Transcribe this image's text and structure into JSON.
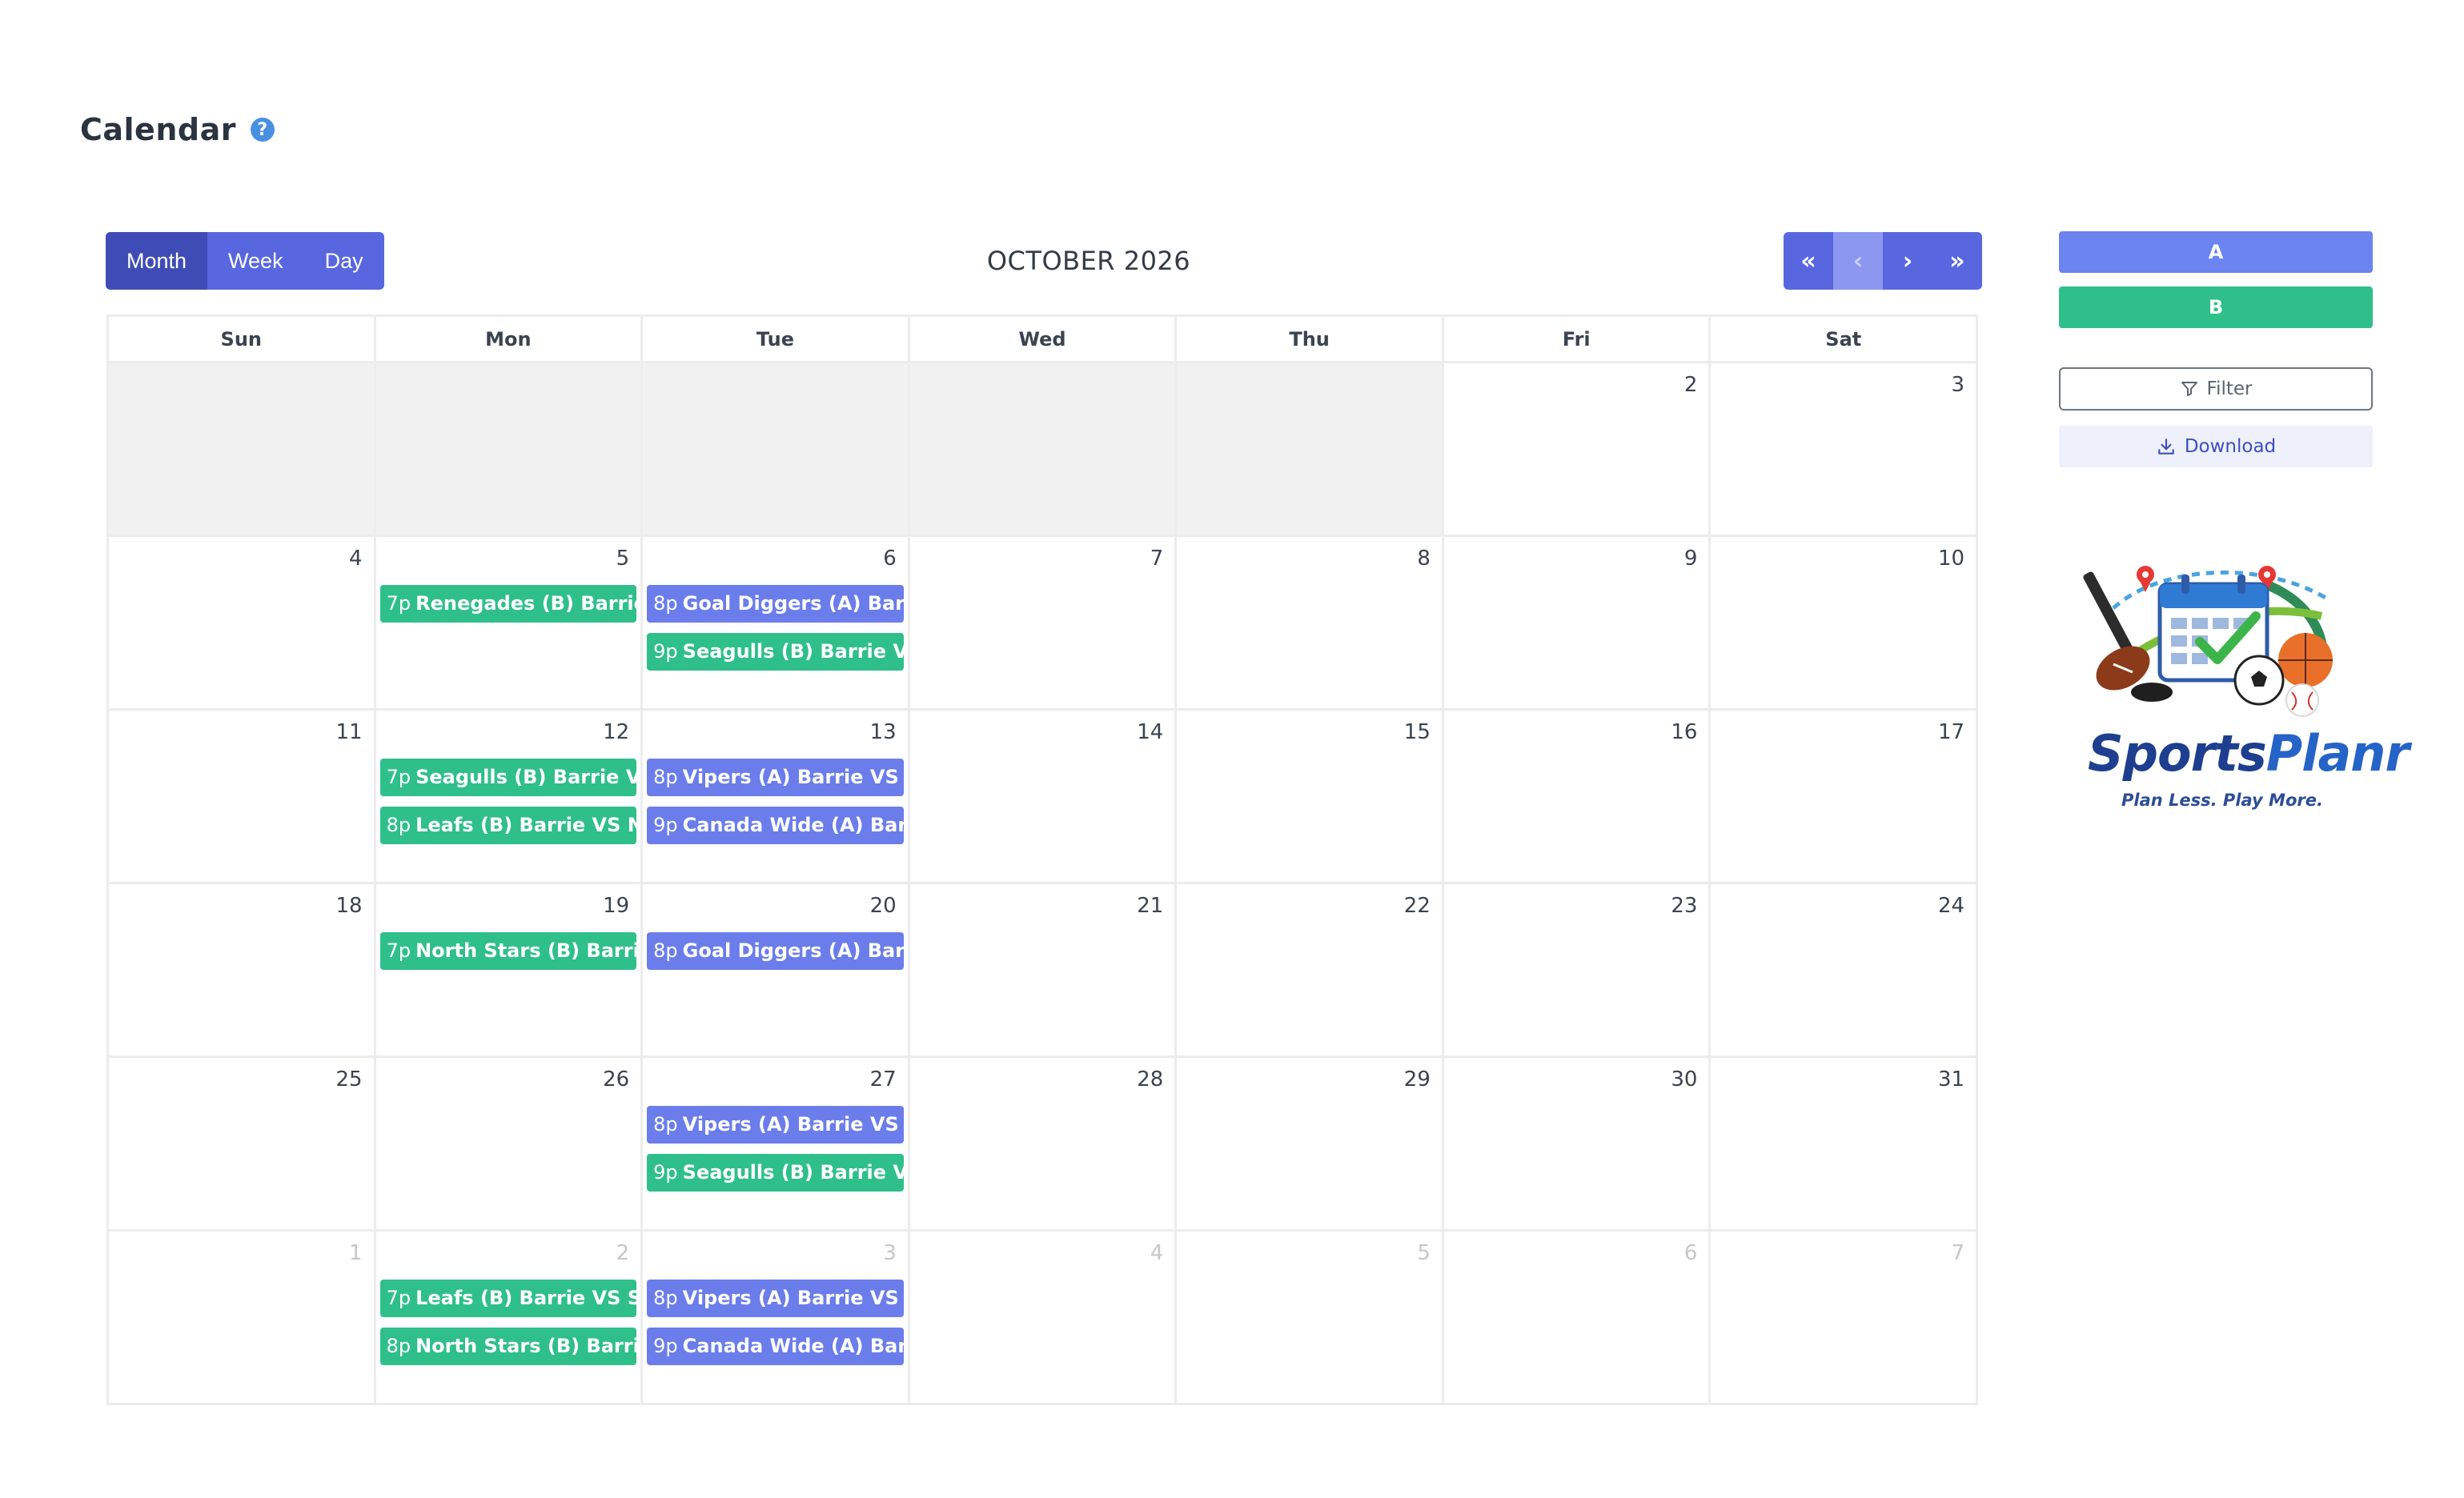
{
  "page": {
    "title": "Calendar",
    "help_icon": "?"
  },
  "toolbar": {
    "views": [
      {
        "label": "Month",
        "active": true
      },
      {
        "label": "Week",
        "active": false
      },
      {
        "label": "Day",
        "active": false
      }
    ],
    "month_title": "OCTOBER 2026",
    "nav": {
      "first": "«",
      "prev": "‹",
      "next": "›",
      "last": "»"
    }
  },
  "calendar": {
    "weekdays": [
      "Sun",
      "Mon",
      "Tue",
      "Wed",
      "Thu",
      "Fri",
      "Sat"
    ],
    "weeks": [
      [
        {
          "empty": true
        },
        {
          "empty": true
        },
        {
          "empty": true
        },
        {
          "empty": true
        },
        {
          "empty": true
        },
        {
          "num": "2",
          "events": []
        },
        {
          "num": "3",
          "events": []
        }
      ],
      [
        {
          "num": "4",
          "events": []
        },
        {
          "num": "5",
          "events": [
            {
              "time": "7p",
              "title": "Renegades (B) Barrie VS",
              "group": "B"
            }
          ]
        },
        {
          "num": "6",
          "events": [
            {
              "time": "8p",
              "title": "Goal Diggers (A) Barrie",
              "group": "A"
            },
            {
              "time": "9p",
              "title": "Seagulls (B) Barrie VS",
              "group": "B"
            }
          ]
        },
        {
          "num": "7",
          "events": []
        },
        {
          "num": "8",
          "events": []
        },
        {
          "num": "9",
          "events": []
        },
        {
          "num": "10",
          "events": []
        }
      ],
      [
        {
          "num": "11",
          "events": []
        },
        {
          "num": "12",
          "events": [
            {
              "time": "7p",
              "title": "Seagulls (B) Barrie VS",
              "group": "B"
            },
            {
              "time": "8p",
              "title": "Leafs (B) Barrie VS Nor",
              "group": "B"
            }
          ]
        },
        {
          "num": "13",
          "events": [
            {
              "time": "8p",
              "title": "Vipers (A) Barrie VS Go",
              "group": "A"
            },
            {
              "time": "9p",
              "title": "Canada Wide (A) Barr",
              "group": "A"
            }
          ]
        },
        {
          "num": "14",
          "events": []
        },
        {
          "num": "15",
          "events": []
        },
        {
          "num": "16",
          "events": []
        },
        {
          "num": "17",
          "events": []
        }
      ],
      [
        {
          "num": "18",
          "events": []
        },
        {
          "num": "19",
          "events": [
            {
              "time": "7p",
              "title": "North Stars (B) Barrie V",
              "group": "B"
            }
          ]
        },
        {
          "num": "20",
          "events": [
            {
              "time": "8p",
              "title": "Goal Diggers (A) Barrie",
              "group": "A"
            }
          ]
        },
        {
          "num": "21",
          "events": []
        },
        {
          "num": "22",
          "events": []
        },
        {
          "num": "23",
          "events": []
        },
        {
          "num": "24",
          "events": []
        }
      ],
      [
        {
          "num": "25",
          "events": []
        },
        {
          "num": "26",
          "events": []
        },
        {
          "num": "27",
          "events": [
            {
              "time": "8p",
              "title": "Vipers (A) Barrie VS Le",
              "group": "A"
            },
            {
              "time": "9p",
              "title": "Seagulls (B) Barrie VS",
              "group": "B"
            }
          ]
        },
        {
          "num": "28",
          "events": []
        },
        {
          "num": "29",
          "events": []
        },
        {
          "num": "30",
          "events": []
        },
        {
          "num": "31",
          "events": []
        }
      ],
      [
        {
          "num": "1",
          "other": true,
          "events": []
        },
        {
          "num": "2",
          "other": true,
          "events": [
            {
              "time": "7p",
              "title": "Leafs (B) Barrie VS Sea",
              "group": "B"
            },
            {
              "time": "8p",
              "title": "North Stars (B) Barrie",
              "group": "B"
            }
          ]
        },
        {
          "num": "3",
          "other": true,
          "events": [
            {
              "time": "8p",
              "title": "Vipers (A) Barrie VS Go",
              "group": "A"
            },
            {
              "time": "9p",
              "title": "Canada Wide (A) Barr",
              "group": "A"
            }
          ]
        },
        {
          "num": "4",
          "other": true,
          "events": []
        },
        {
          "num": "5",
          "other": true,
          "events": []
        },
        {
          "num": "6",
          "other": true,
          "events": []
        },
        {
          "num": "7",
          "other": true,
          "events": []
        }
      ]
    ]
  },
  "sidebar": {
    "legend_a": "A",
    "legend_b": "B",
    "filter_label": "Filter",
    "filter_icon": "funnel-icon",
    "download_label": "Download",
    "download_icon": "download-icon",
    "logo": {
      "word_sports": "Sports",
      "word_planr": "Planr",
      "tagline": "Plan Less. Play More."
    }
  },
  "colors": {
    "group_a": "#6b7deb",
    "group_b": "#2fbf8a",
    "primary": "#5866e0",
    "primary_active": "#3f4cb6"
  }
}
